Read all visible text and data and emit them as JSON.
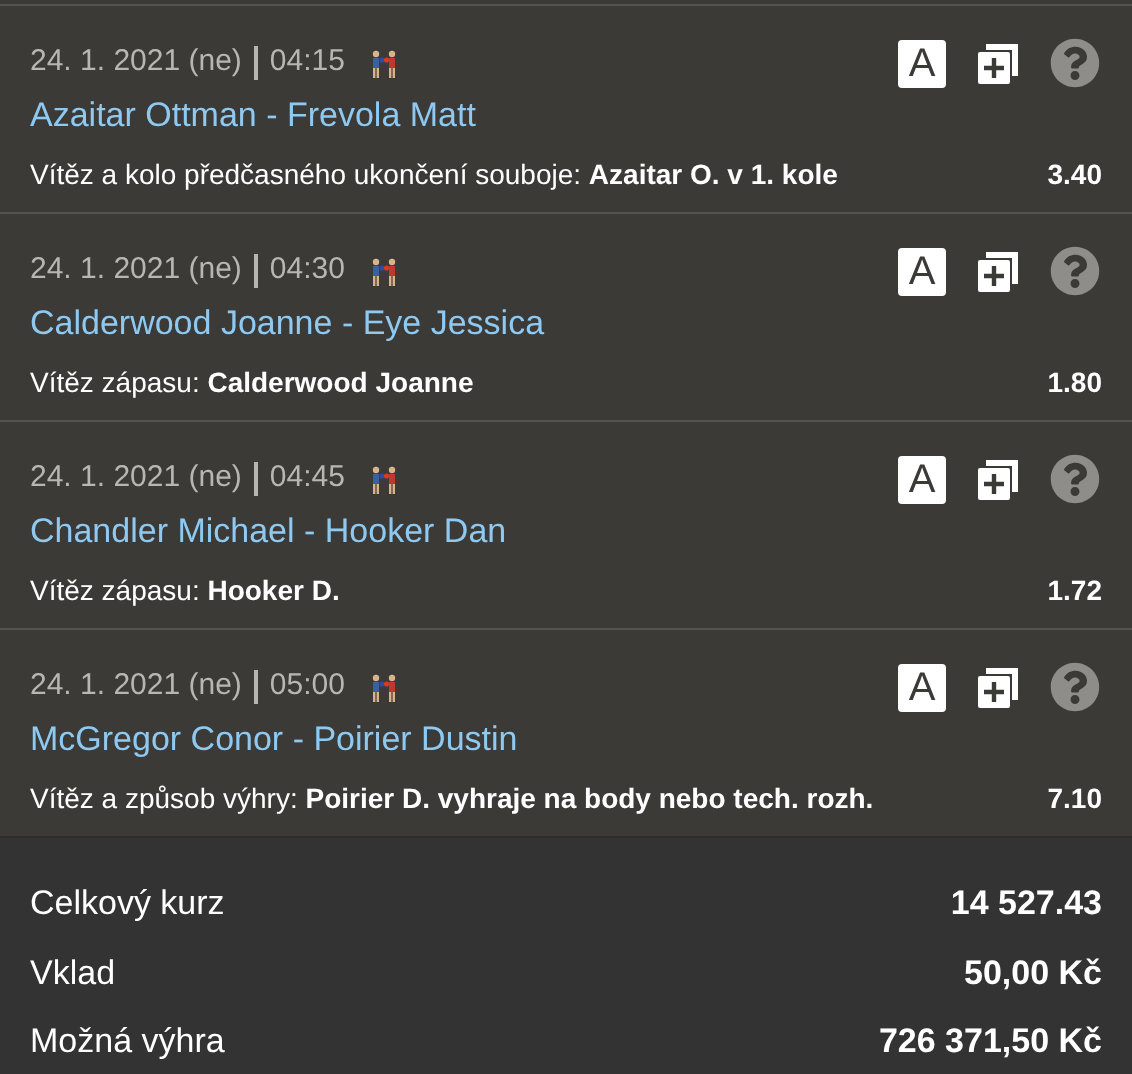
{
  "events": [
    {
      "date": "24. 1. 2021 (ne)",
      "time": "04:15",
      "match": "Azaitar Ottman - Frevola Matt",
      "bet_label": "Vítěz a kolo předčasného ukončení souboje:",
      "bet_pick": "Azaitar O. v 1. kole",
      "odds": "3.40",
      "key_label": "A"
    },
    {
      "date": "24. 1. 2021 (ne)",
      "time": "04:30",
      "match": "Calderwood Joanne - Eye Jessica",
      "bet_label": "Vítěz zápasu:",
      "bet_pick": "Calderwood Joanne",
      "odds": "1.80",
      "key_label": "A"
    },
    {
      "date": "24. 1. 2021 (ne)",
      "time": "04:45",
      "match": "Chandler Michael - Hooker Dan",
      "bet_label": "Vítěz zápasu:",
      "bet_pick": "Hooker D.",
      "odds": "1.72",
      "key_label": "A"
    },
    {
      "date": "24. 1. 2021 (ne)",
      "time": "05:00",
      "match": "McGregor Conor - Poirier Dustin",
      "bet_label": "Vítěz a způsob výhry:",
      "bet_pick": "Poirier D. vyhraje na body nebo tech. rozh.",
      "odds": "7.10",
      "key_label": "A"
    }
  ],
  "summary": [
    {
      "label": "Celkový kurz",
      "value": "14 527.43"
    },
    {
      "label": "Vklad",
      "value": "50,00 Kč"
    },
    {
      "label": "Možná výhra",
      "value": "726 371,50 Kč"
    }
  ]
}
